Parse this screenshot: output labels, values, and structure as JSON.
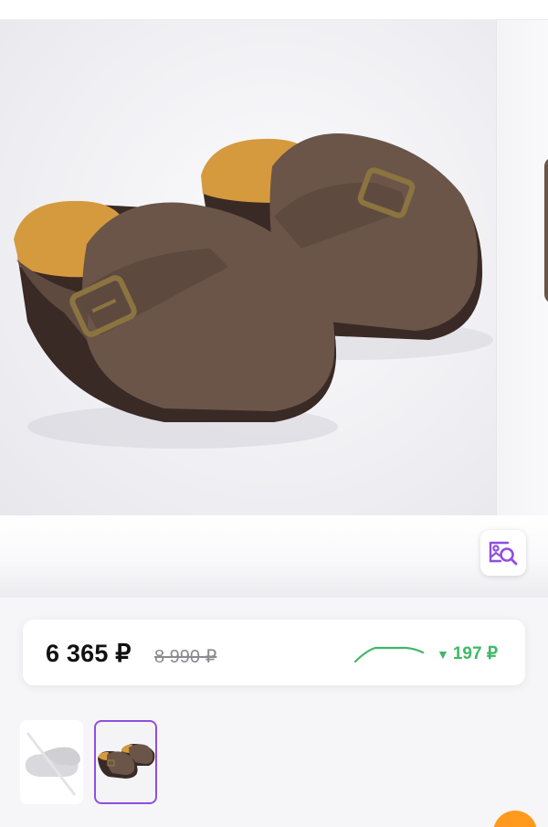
{
  "product": {
    "image_alt": "Brown suede clogs with buckle strap",
    "colors": {
      "suede": "#6b5549",
      "cork": "#d59a3e",
      "sole": "#3a2a26",
      "buckle": "#8b7440"
    }
  },
  "visual_search": {
    "icon": "image-search-icon",
    "color": "#8f4fe0"
  },
  "price": {
    "current": "6 365 ₽",
    "old": "8 990 ₽",
    "drop": "197 ₽",
    "drop_icon": "down-triangle-icon",
    "drop_color": "#3fb867"
  },
  "thumbnails": [
    {
      "name": "thumbnail-placeholder",
      "selected": false
    },
    {
      "name": "thumbnail-clogs",
      "selected": true
    }
  ],
  "accent_color": "#8f4fe0",
  "fab_color": "#ff9a1f"
}
